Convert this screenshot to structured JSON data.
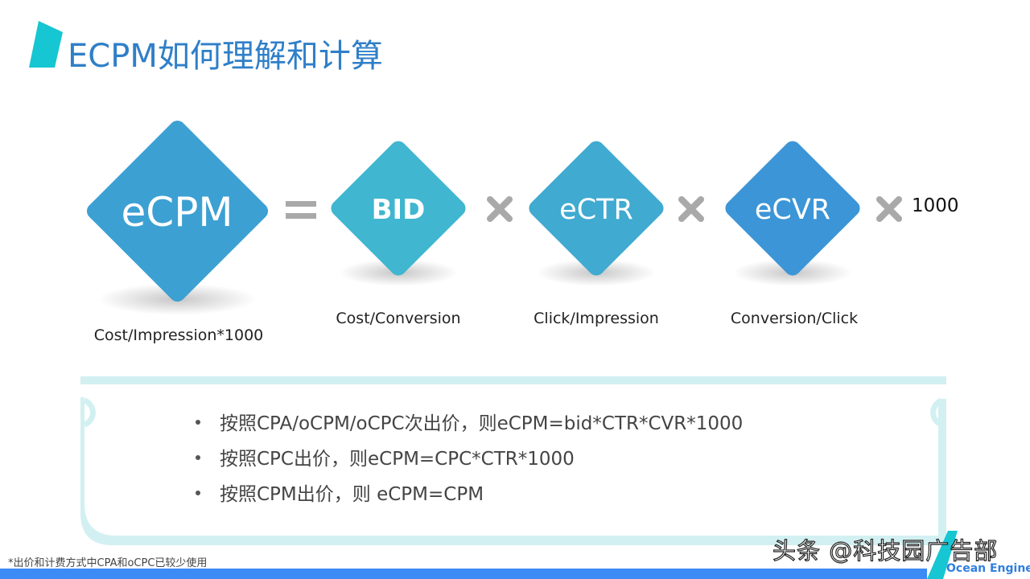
{
  "slide": {
    "title": "ECPM如何理解和计算",
    "colors": {
      "title": "#2f7fc8",
      "accent_teal": "#16c6d2",
      "ecpm_diamond": "#3da0d3",
      "bid_diamond": "#40b6d0",
      "ectr_diamond": "#40aad1",
      "ecvr_diamond": "#3c95d6",
      "operator_gray": "#a9a9a9",
      "panel_border": "#d2f0f2",
      "bottom_bar": "#3d8bf5"
    }
  },
  "formula": {
    "terms": [
      {
        "id": "ecpm",
        "label": "eCPM",
        "caption": "Cost/Impression*1000"
      },
      {
        "id": "bid",
        "label": "BID",
        "caption": "Cost/Conversion"
      },
      {
        "id": "ectr",
        "label": "eCTR",
        "caption": "Click/Impression"
      },
      {
        "id": "ecvr",
        "label": "eCVR",
        "caption": "Conversion/Click"
      }
    ],
    "equals_icon": "equals-icon",
    "multiply_icon": "multiply-icon",
    "constant": "1000"
  },
  "notes": {
    "bullets": [
      "按照CPA/oCPM/oCPC次出价，则eCPM=bid*CTR*CVR*1000",
      "按照CPC出价，则eCPM=CPC*CTR*1000",
      "按照CPM出价，则 eCPM=CPM"
    ]
  },
  "footer": {
    "footnote": "*出价和计费方式中CPA和oCPC已较少使用",
    "watermark": "头条 @科技园广告部",
    "brand": "Ocean Engine"
  }
}
